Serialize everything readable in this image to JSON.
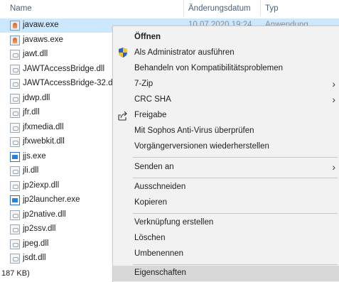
{
  "columns": {
    "name": "Name",
    "date": "Änderungsdatum",
    "type": "Typ"
  },
  "files": [
    {
      "name": "javaw.exe",
      "icon": "java-exe-icon",
      "date": "10.07.2020 19:24",
      "type": "Anwendung",
      "selected": true
    },
    {
      "name": "javaws.exe",
      "icon": "java-exe-icon"
    },
    {
      "name": "jawt.dll",
      "icon": "dll-file-icon"
    },
    {
      "name": "JAWTAccessBridge.dll",
      "icon": "dll-file-icon"
    },
    {
      "name": "JAWTAccessBridge-32.d",
      "icon": "dll-file-icon"
    },
    {
      "name": "jdwp.dll",
      "icon": "dll-file-icon"
    },
    {
      "name": "jfr.dll",
      "icon": "dll-file-icon"
    },
    {
      "name": "jfxmedia.dll",
      "icon": "dll-file-icon"
    },
    {
      "name": "jfxwebkit.dll",
      "icon": "dll-file-icon"
    },
    {
      "name": "jjs.exe",
      "icon": "exe-window-icon"
    },
    {
      "name": "jli.dll",
      "icon": "dll-file-icon"
    },
    {
      "name": "jp2iexp.dll",
      "icon": "dll-file-icon"
    },
    {
      "name": "jp2launcher.exe",
      "icon": "exe-window-icon"
    },
    {
      "name": "jp2native.dll",
      "icon": "dll-file-icon"
    },
    {
      "name": "jp2ssv.dll",
      "icon": "dll-file-icon"
    },
    {
      "name": "jpeg.dll",
      "icon": "dll-file-icon"
    },
    {
      "name": "jsdt.dll",
      "icon": "dll-file-icon"
    }
  ],
  "status": {
    "text": "187 KB)"
  },
  "menu": {
    "open": "Öffnen",
    "run_as_admin": "Als Administrator ausführen",
    "troubleshoot": "Behandeln von Kompatibilitätsproblemen",
    "zip": "7-Zip",
    "crc": "CRC SHA",
    "share": "Freigabe",
    "sophos": "Mit Sophos Anti-Virus überprüfen",
    "restore": "Vorgängerversionen wiederherstellen",
    "send_to": "Senden an",
    "cut": "Ausschneiden",
    "copy": "Kopieren",
    "create_shortcut": "Verknüpfung erstellen",
    "delete": "Löschen",
    "rename": "Umbenennen",
    "properties": "Eigenschaften"
  },
  "icons": {
    "submenu": "chevron-right-icon",
    "admin": "uac-shield-icon",
    "share": "share-icon"
  },
  "colors": {
    "selection": "#cce8ff",
    "menu_bg": "#f2f2f2",
    "menu_hover": "#d8d8d8",
    "header_text": "#4c607a"
  }
}
